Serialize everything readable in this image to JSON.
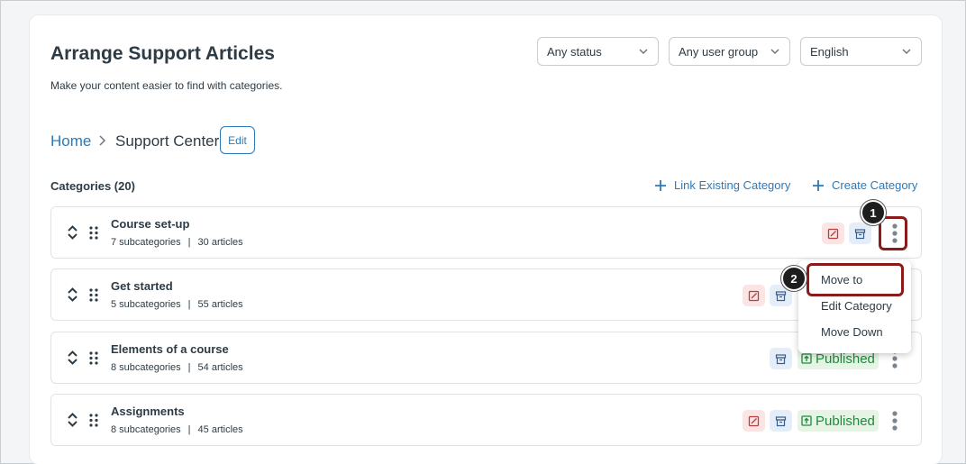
{
  "header": {
    "title": "Arrange Support Articles",
    "subtitle": "Make your content easier to find with categories."
  },
  "filters": {
    "status": "Any status",
    "user_group": "Any user group",
    "language": "English"
  },
  "breadcrumb": {
    "home": "Home",
    "current": "Support Center",
    "edit_label": "Edit"
  },
  "categories": {
    "count_label": "Categories (20)",
    "link_existing_label": "Link Existing Category",
    "create_label": "Create Category",
    "items": [
      {
        "name": "Course set-up",
        "subcategories": "7 subcategories",
        "articles": "30 articles",
        "status": ""
      },
      {
        "name": "Get started",
        "subcategories": "5 subcategories",
        "articles": "55 articles",
        "status": ""
      },
      {
        "name": "Elements of a course",
        "subcategories": "8 subcategories",
        "articles": "54 articles",
        "status": "Published"
      },
      {
        "name": "Assignments",
        "subcategories": "8 subcategories",
        "articles": "45 articles",
        "status": "Published"
      }
    ]
  },
  "menu": {
    "items": [
      "Move to",
      "Edit Category",
      "Move Down"
    ]
  },
  "callouts": [
    "1",
    "2"
  ],
  "colors": {
    "accent": "#2b7abc",
    "highlight": "#8b1a1a",
    "published_text": "#1f8a3c",
    "published_bg": "#e6f4e6"
  },
  "icons": {
    "sort": "sort-arrows-icon",
    "drag": "drag-handle-icon",
    "draft": "edit-draft-icon",
    "archive": "archive-icon",
    "published": "published-icon",
    "kebab": "kebab-menu-icon",
    "chevron": "chevron-down-icon",
    "plus": "plus-icon"
  }
}
